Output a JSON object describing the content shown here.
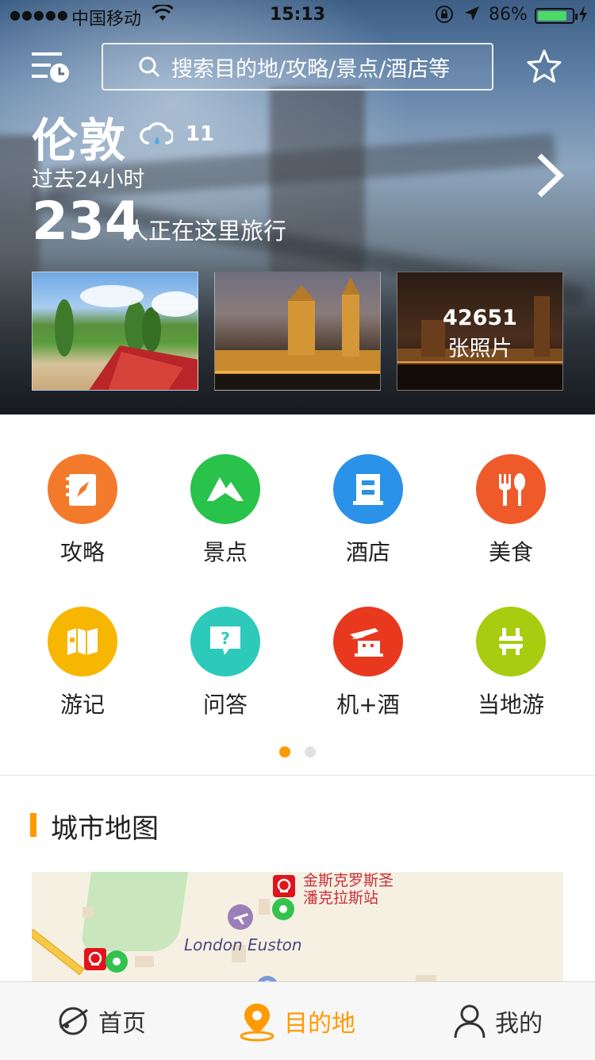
{
  "status_bar": {
    "signal_dots": "●●●●●",
    "carrier": "中国移动",
    "time": "15:13",
    "battery_percent": "86%",
    "battery_level": 0.86
  },
  "header": {
    "search_placeholder": "搜索目的地/攻略/景点/酒店等"
  },
  "destination": {
    "city": "伦敦",
    "temperature": "11",
    "past_label": "过去24小时",
    "traveler_count": "234",
    "traveler_label": "人正在这里旅行"
  },
  "photos": {
    "count": "42651",
    "label": "张照片"
  },
  "categories": [
    {
      "label": "攻略",
      "color": "#f47a2b",
      "icon": "guide-compass-icon"
    },
    {
      "label": "景点",
      "color": "#29c24a",
      "icon": "mountain-icon"
    },
    {
      "label": "酒店",
      "color": "#2a92e8",
      "icon": "hotel-building-icon"
    },
    {
      "label": "美食",
      "color": "#ef5a2a",
      "icon": "fork-spoon-icon"
    },
    {
      "label": "游记",
      "color": "#f7b600",
      "icon": "map-book-icon"
    },
    {
      "label": "问答",
      "color": "#2dcabb",
      "icon": "question-bubble-icon"
    },
    {
      "label": "机+酒",
      "color": "#e8391f",
      "icon": "flight-hotel-icon"
    },
    {
      "label": "当地游",
      "color": "#a8cc0f",
      "icon": "local-tour-icon"
    }
  ],
  "pager": {
    "pages": 2,
    "current": 1
  },
  "city_map": {
    "title": "城市地图",
    "station_label_line1": "金斯克罗斯圣",
    "station_label_line2": "潘克拉斯站",
    "euston_label": "London Euston"
  },
  "tabbar": {
    "home": "首页",
    "destination": "目的地",
    "mine": "我的",
    "active_color": "#ff9a00"
  }
}
